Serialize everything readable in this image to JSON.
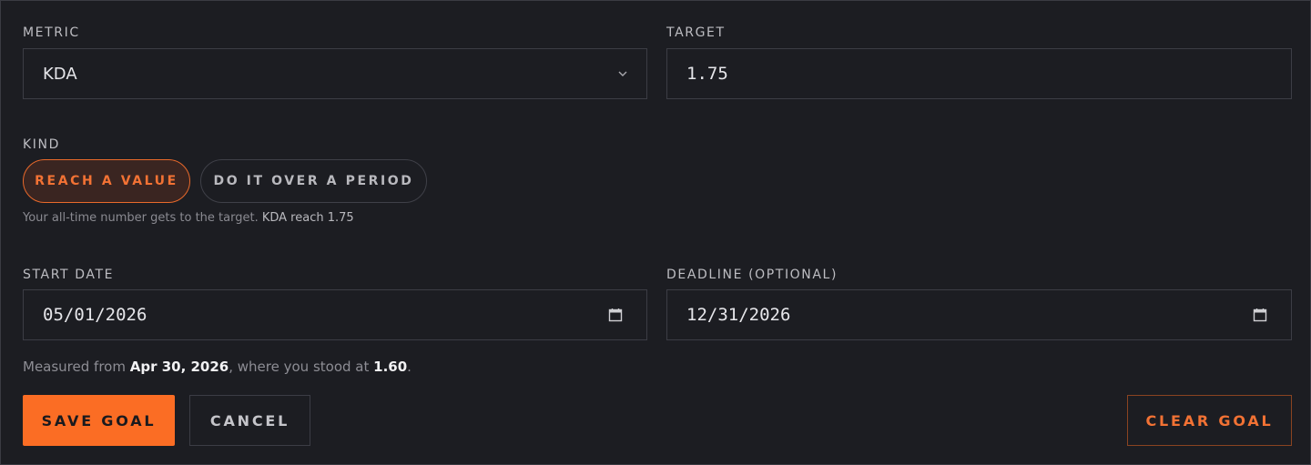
{
  "metric": {
    "label": "METRIC",
    "value": "KDA"
  },
  "target": {
    "label": "TARGET",
    "value": "1.75"
  },
  "kind": {
    "label": "KIND",
    "options": [
      "REACH A VALUE",
      "DO IT OVER A PERIOD"
    ],
    "selected": "REACH A VALUE",
    "hint": "Your all-time number gets to the target.",
    "hint_summary": "KDA reach 1.75"
  },
  "start_date": {
    "label": "START DATE",
    "value": "05/01/2026"
  },
  "deadline": {
    "label": "DEADLINE (OPTIONAL)",
    "value": "12/31/2026"
  },
  "measured": {
    "prefix": "Measured from",
    "date": "Apr 30, 2026",
    "middle": ", where you stood at",
    "value": "1.60",
    "suffix": "."
  },
  "actions": {
    "save_label": "SAVE GOAL",
    "cancel_label": "CANCEL",
    "clear_label": "CLEAR GOAL"
  },
  "colors": {
    "accent": "#fb6d24",
    "background": "#1c1d22",
    "border": "#3c3d45"
  },
  "icons": {
    "metric_dropdown": "chevron-down-icon",
    "date_picker": "calendar-icon"
  }
}
